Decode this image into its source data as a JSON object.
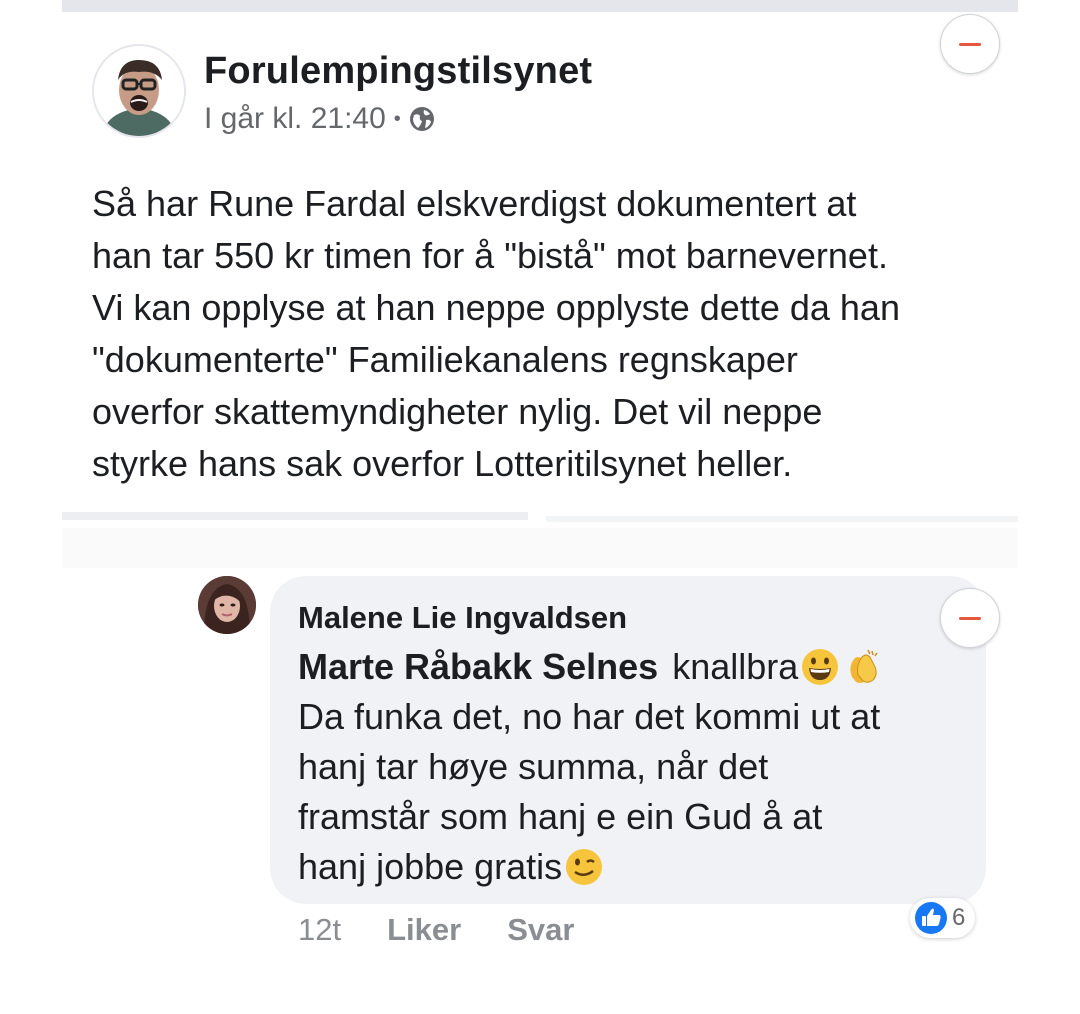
{
  "post": {
    "author": "Forulempingstilsynet",
    "time": "I går kl. 21:40",
    "separator": "•",
    "privacy_icon": "globe-icon",
    "text_lines": [
      "Så har Rune Fardal elskverdigst dokumentert at",
      "han tar 550 kr timen for å \"bistå\" mot barnevernet.",
      "Vi kan opplyse at han neppe opplyste dette da han",
      "\"dokumenterte\" Familiekanalens regnskaper",
      "overfor skattemyndigheter nylig. Det vil neppe",
      "styrke hans sak overfor Lotteritilsynet heller."
    ]
  },
  "comment": {
    "author": "Malene Lie Ingvaldsen",
    "mention": "Marte Råbakk Selnes",
    "first_line_text": "knallbra",
    "lines": [
      "Da funka det, no har det kommi ut at",
      "hanj tar høye summa, når det",
      "framstår som hanj e ein Gud å at",
      "hanj jobbe gratis"
    ],
    "emojis": [
      "grinning-face-emoji",
      "clapping-hands-emoji",
      "winking-face-emoji"
    ],
    "time": "12t",
    "like_label": "Liker",
    "reply_label": "Svar",
    "reaction_count": "6"
  },
  "colors": {
    "collapse_accent": "#e5573f",
    "like_blue": "#1877f2",
    "meta_grey": "#65676b",
    "bubble_bg": "#f0f2f5"
  }
}
